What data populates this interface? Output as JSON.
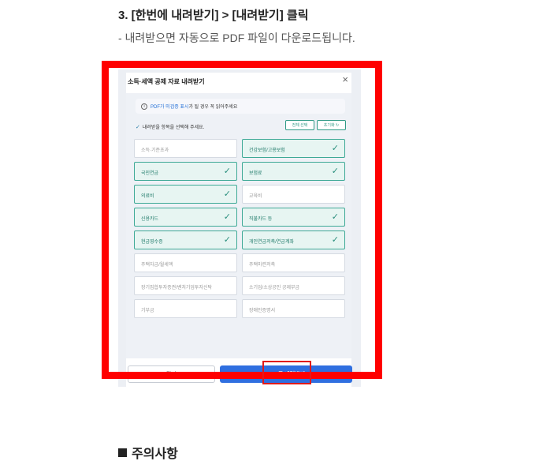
{
  "step": {
    "heading": "3. [한번에 내려받기] > [내려받기] 클릭",
    "description": "- 내려받으면 자동으로 PDF 파일이 다운로드됩니다."
  },
  "dialog": {
    "title": "소득·세액 공제 자료 내려받기",
    "close_glyph": "×",
    "notice_em": "PDF가 미검증 표시",
    "notice_rest": "가 될 경우 꼭 읽어주세요",
    "guide": "내려받을 항목을 선택해 주세요.",
    "select_all": "전체 선택",
    "reset": "초기화 ↻",
    "items": [
      {
        "label": "소득·기준초과",
        "selected": false
      },
      {
        "label": "건강보험/고용보험",
        "selected": true
      },
      {
        "label": "국민연금",
        "selected": true
      },
      {
        "label": "보험료",
        "selected": true
      },
      {
        "label": "의료비",
        "selected": true
      },
      {
        "label": "교육비",
        "selected": false
      },
      {
        "label": "신용카드",
        "selected": true
      },
      {
        "label": "직불카드 등",
        "selected": true
      },
      {
        "label": "현금영수증",
        "selected": true
      },
      {
        "label": "개인연금저축/연금계좌",
        "selected": true
      },
      {
        "label": "주택자금/월세액",
        "selected": false
      },
      {
        "label": "주택마련저축",
        "selected": false
      },
      {
        "label": "장기집합투자증권/벤처기업투자신탁",
        "selected": false
      },
      {
        "label": "소기업/소상공인 공제부금",
        "selected": false
      },
      {
        "label": "기부금",
        "selected": false
      },
      {
        "label": "장애인증명서",
        "selected": false
      }
    ],
    "close_button": "닫기",
    "download_button": "PDF로 내려받기"
  },
  "section": {
    "heading": "주의사항"
  }
}
